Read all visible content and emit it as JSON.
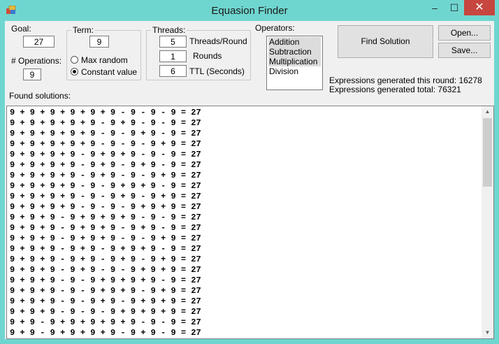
{
  "window": {
    "title": "Equasion Finder",
    "minimize_glyph": "–",
    "maximize_glyph": "☐",
    "close_glyph": "✕"
  },
  "goal": {
    "label": "Goal:",
    "value": "27"
  },
  "operations": {
    "label": "# Operations:",
    "value": "9"
  },
  "term": {
    "title": "Term:",
    "value": "9",
    "options": [
      {
        "label": "Max random",
        "selected": false
      },
      {
        "label": "Constant value",
        "selected": true
      }
    ]
  },
  "threads": {
    "title": "Threads:",
    "fields": [
      {
        "value": "5",
        "label": "Threads/Round"
      },
      {
        "value": "1",
        "label": "Rounds"
      },
      {
        "value": "6",
        "label": "TTL (Seconds)"
      }
    ]
  },
  "operators": {
    "label": "Operators:",
    "items": [
      "Addition",
      "Subtraction",
      "Multiplication",
      "Division"
    ],
    "selected": [
      0,
      1,
      2
    ]
  },
  "buttons": {
    "find": "Find Solution",
    "open": "Open...",
    "save": "Save..."
  },
  "stats": {
    "this_round": "Expressions generated this round: 16278",
    "total": "Expressions generated total: 76321"
  },
  "found_label": "Found solutions:",
  "solutions": [
    "9 + 9 + 9 + 9 + 9 + 9 - 9 - 9 - 9 = 27",
    "9 + 9 + 9 + 9 + 9 - 9 + 9 - 9 - 9 = 27",
    "9 + 9 + 9 + 9 + 9 - 9 - 9 + 9 - 9 = 27",
    "9 + 9 + 9 + 9 + 9 - 9 - 9 - 9 + 9 = 27",
    "9 + 9 + 9 + 9 - 9 + 9 + 9 - 9 - 9 = 27",
    "9 + 9 + 9 + 9 - 9 + 9 - 9 + 9 - 9 = 27",
    "9 + 9 + 9 + 9 - 9 + 9 - 9 - 9 + 9 = 27",
    "9 + 9 + 9 + 9 - 9 - 9 + 9 + 9 - 9 = 27",
    "9 + 9 + 9 + 9 - 9 - 9 + 9 - 9 + 9 = 27",
    "9 + 9 + 9 + 9 - 9 - 9 - 9 + 9 + 9 = 27",
    "9 + 9 + 9 - 9 + 9 + 9 + 9 - 9 - 9 = 27",
    "9 + 9 + 9 - 9 + 9 + 9 - 9 + 9 - 9 = 27",
    "9 + 9 + 9 - 9 + 9 + 9 - 9 - 9 + 9 = 27",
    "9 + 9 + 9 - 9 + 9 - 9 + 9 + 9 - 9 = 27",
    "9 + 9 + 9 - 9 + 9 - 9 + 9 - 9 + 9 = 27",
    "9 + 9 + 9 - 9 + 9 - 9 - 9 + 9 + 9 = 27",
    "9 + 9 + 9 - 9 - 9 + 9 + 9 + 9 - 9 = 27",
    "9 + 9 + 9 - 9 - 9 + 9 + 9 - 9 + 9 = 27",
    "9 + 9 + 9 - 9 - 9 + 9 - 9 + 9 + 9 = 27",
    "9 + 9 + 9 - 9 - 9 - 9 + 9 + 9 + 9 = 27",
    "9 + 9 - 9 + 9 + 9 + 9 + 9 - 9 - 9 = 27",
    "9 + 9 - 9 + 9 + 9 + 9 - 9 + 9 - 9 = 27"
  ],
  "colors": {
    "titlebar": "#6fd6cf",
    "close": "#c7463f",
    "client": "#f0f0f0"
  }
}
